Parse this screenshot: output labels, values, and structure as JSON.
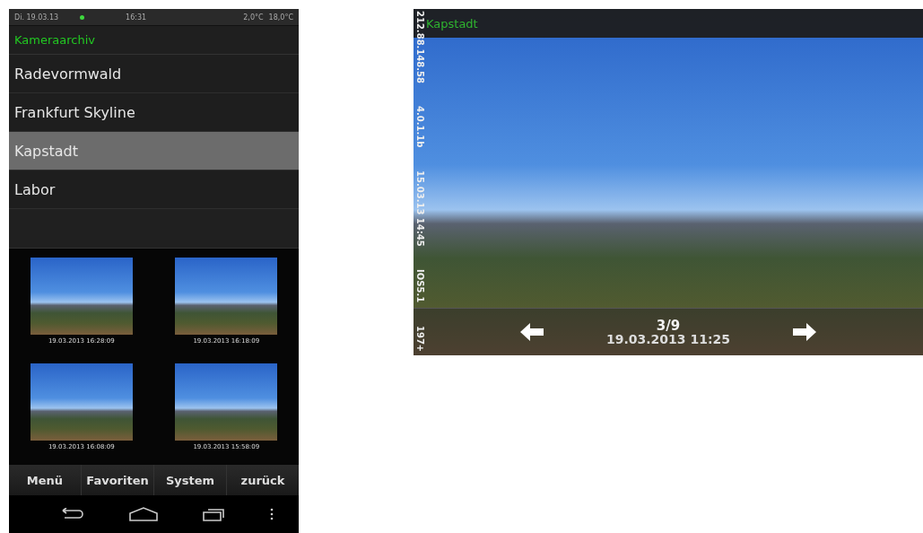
{
  "status_bar": {
    "date": "Di. 19.03.13",
    "time": "16:31",
    "outdoor_temp": "2,0°C",
    "indoor_temp": "18,0°C"
  },
  "title": "Kameraarchiv",
  "cameras": [
    {
      "label": "Radevormwald",
      "selected": false
    },
    {
      "label": "Frankfurt Skyline",
      "selected": false
    },
    {
      "label": "Kapstadt",
      "selected": true
    },
    {
      "label": "Labor",
      "selected": false
    }
  ],
  "thumbnails": [
    {
      "timestamp": "19.03.2013 16:28:09"
    },
    {
      "timestamp": "19.03.2013 16:18:09"
    },
    {
      "timestamp": "19.03.2013 16:08:09"
    },
    {
      "timestamp": "19.03.2013 15:58:09"
    }
  ],
  "bottom_menu": [
    "Menü",
    "Favoriten",
    "System",
    "zurück"
  ],
  "viewer": {
    "title": "Kapstadt",
    "side_info": [
      "212.88.148.58",
      "4.0.1.1b",
      "15.03.13 14:45",
      "IOS5.1",
      "197+"
    ],
    "counter": "3/9",
    "timestamp": "19.03.2013 11:25"
  }
}
